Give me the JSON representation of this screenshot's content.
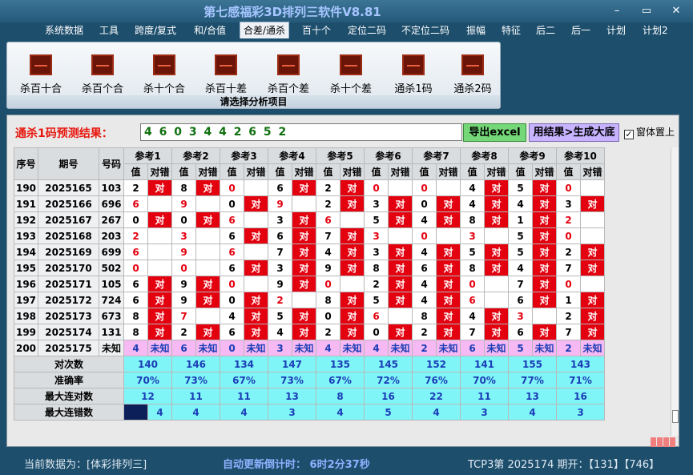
{
  "window": {
    "title": "第七感福彩3D排列三软件V8.81",
    "min": "–",
    "max": "▭",
    "close": "✕"
  },
  "menu": [
    "系统数据",
    "工具",
    "跨度/复式",
    "和/合值",
    "合差/通杀",
    "百十个",
    "定位二码",
    "不定位二码",
    "振幅",
    "特征",
    "后二",
    "后一",
    "计划",
    "计划2"
  ],
  "ribbon": {
    "buttons": [
      "杀百十合",
      "杀百个合",
      "杀十个合",
      "杀百十差",
      "杀百个差",
      "杀十个差",
      "通杀1码",
      "通杀2码"
    ],
    "caption": "请选择分析项目",
    "icon": "chart-icon"
  },
  "panel": {
    "pred_label": "通杀1码预测结果：",
    "pred_value": "4 6 0 3 4 4 2 6 5 2",
    "export_btn": "导出excel",
    "gen_btn": "用结果>生成大底",
    "ontop_label": "窗体置上",
    "ontop_checked": "✓"
  },
  "table": {
    "h_seq": "序号",
    "h_period": "期号",
    "h_num": "号码",
    "refs": [
      "参考1",
      "参考2",
      "参考3",
      "参考4",
      "参考5",
      "参考6",
      "参考7",
      "参考8",
      "参考9",
      "参考10"
    ],
    "sub_val": "值",
    "sub_ok": "对错",
    "hit": "对",
    "rows": [
      {
        "seq": "190",
        "period": "2025165",
        "num": "103",
        "vals": [
          "2",
          "8",
          "0",
          "6",
          "2",
          "0",
          "0",
          "4",
          "5",
          "0"
        ],
        "hits": [
          1,
          1,
          0,
          1,
          1,
          0,
          0,
          1,
          1,
          0
        ],
        "red": [
          0,
          0,
          1,
          0,
          0,
          1,
          1,
          0,
          0,
          1
        ]
      },
      {
        "seq": "191",
        "period": "2025166",
        "num": "696",
        "vals": [
          "6",
          "9",
          "0",
          "9",
          "2",
          "3",
          "0",
          "4",
          "4",
          "3"
        ],
        "hits": [
          0,
          0,
          1,
          0,
          1,
          1,
          1,
          1,
          1,
          1
        ],
        "red": [
          1,
          1,
          0,
          1,
          0,
          0,
          0,
          0,
          0,
          0
        ]
      },
      {
        "seq": "192",
        "period": "2025167",
        "num": "267",
        "vals": [
          "0",
          "0",
          "6",
          "3",
          "6",
          "5",
          "4",
          "8",
          "1",
          "2"
        ],
        "hits": [
          1,
          1,
          0,
          1,
          0,
          1,
          1,
          1,
          1,
          0
        ],
        "red": [
          0,
          0,
          1,
          0,
          1,
          0,
          0,
          0,
          0,
          1
        ]
      },
      {
        "seq": "193",
        "period": "2025168",
        "num": "203",
        "vals": [
          "2",
          "3",
          "6",
          "6",
          "7",
          "3",
          "0",
          "3",
          "5",
          "0"
        ],
        "hits": [
          0,
          0,
          1,
          1,
          1,
          0,
          0,
          0,
          1,
          0
        ],
        "red": [
          1,
          1,
          0,
          0,
          0,
          1,
          1,
          1,
          0,
          1
        ]
      },
      {
        "seq": "194",
        "period": "2025169",
        "num": "699",
        "vals": [
          "6",
          "9",
          "6",
          "7",
          "4",
          "3",
          "4",
          "5",
          "5",
          "2"
        ],
        "hits": [
          0,
          0,
          0,
          1,
          1,
          1,
          1,
          1,
          1,
          1
        ],
        "red": [
          1,
          1,
          1,
          0,
          0,
          0,
          0,
          0,
          0,
          0
        ]
      },
      {
        "seq": "195",
        "period": "2025170",
        "num": "502",
        "vals": [
          "0",
          "0",
          "6",
          "3",
          "9",
          "8",
          "6",
          "8",
          "4",
          "7"
        ],
        "hits": [
          0,
          0,
          1,
          1,
          1,
          1,
          1,
          1,
          1,
          1
        ],
        "red": [
          1,
          1,
          0,
          0,
          0,
          0,
          0,
          0,
          0,
          0
        ]
      },
      {
        "seq": "196",
        "period": "2025171",
        "num": "105",
        "vals": [
          "6",
          "9",
          "0",
          "9",
          "0",
          "2",
          "4",
          "0",
          "7",
          "0"
        ],
        "hits": [
          1,
          1,
          0,
          1,
          0,
          1,
          1,
          0,
          1,
          0
        ],
        "red": [
          0,
          0,
          1,
          0,
          1,
          0,
          0,
          1,
          0,
          1
        ]
      },
      {
        "seq": "197",
        "period": "2025172",
        "num": "724",
        "vals": [
          "6",
          "9",
          "0",
          "2",
          "8",
          "5",
          "4",
          "6",
          "6",
          "1"
        ],
        "hits": [
          1,
          1,
          1,
          0,
          1,
          1,
          1,
          0,
          1,
          1
        ],
        "red": [
          0,
          0,
          0,
          1,
          0,
          0,
          0,
          1,
          0,
          0
        ]
      },
      {
        "seq": "198",
        "period": "2025173",
        "num": "673",
        "vals": [
          "8",
          "7",
          "4",
          "5",
          "0",
          "6",
          "8",
          "4",
          "3",
          "2"
        ],
        "hits": [
          1,
          0,
          1,
          1,
          1,
          0,
          1,
          1,
          0,
          1
        ],
        "red": [
          0,
          1,
          0,
          0,
          0,
          1,
          0,
          0,
          1,
          0
        ]
      },
      {
        "seq": "199",
        "period": "2025174",
        "num": "131",
        "vals": [
          "8",
          "2",
          "6",
          "4",
          "2",
          "0",
          "2",
          "7",
          "6",
          "7"
        ],
        "hits": [
          1,
          1,
          1,
          1,
          1,
          1,
          1,
          1,
          1,
          1
        ],
        "red": [
          0,
          0,
          0,
          0,
          0,
          0,
          0,
          0,
          0,
          0
        ]
      },
      {
        "seq": "200",
        "period": "2025175",
        "num": "未知",
        "vals": [
          "4",
          "6",
          "0",
          "3",
          "4",
          "4",
          "2",
          "6",
          "5",
          "2"
        ],
        "unknown": "未知"
      }
    ],
    "stats": [
      {
        "label": "对次数",
        "vals": [
          "140",
          "146",
          "134",
          "147",
          "135",
          "145",
          "152",
          "141",
          "155",
          "143"
        ]
      },
      {
        "label": "准确率",
        "vals": [
          "70%",
          "73%",
          "67%",
          "73%",
          "67%",
          "72%",
          "76%",
          "70%",
          "77%",
          "71%"
        ]
      },
      {
        "label": "最大连对数",
        "vals": [
          "12",
          "11",
          "11",
          "13",
          "8",
          "16",
          "22",
          "11",
          "13",
          "16"
        ]
      },
      {
        "label": "最大连错数",
        "vals": [
          "4",
          "4",
          "4",
          "3",
          "4",
          "5",
          "4",
          "3",
          "4",
          "3"
        ]
      }
    ]
  },
  "status": {
    "current": "当前数据为：[体彩排列三]",
    "countdown": "自动更新倒计时： 6时2分37秒",
    "info": "TCP3第 2025174 期开：【131】【746】"
  },
  "colors": {
    "hit": "#e3000f",
    "predict_row": "#f6b9f3",
    "stats": "#80f5f8",
    "export": "#74d879",
    "gen": "#c7b3ff"
  }
}
